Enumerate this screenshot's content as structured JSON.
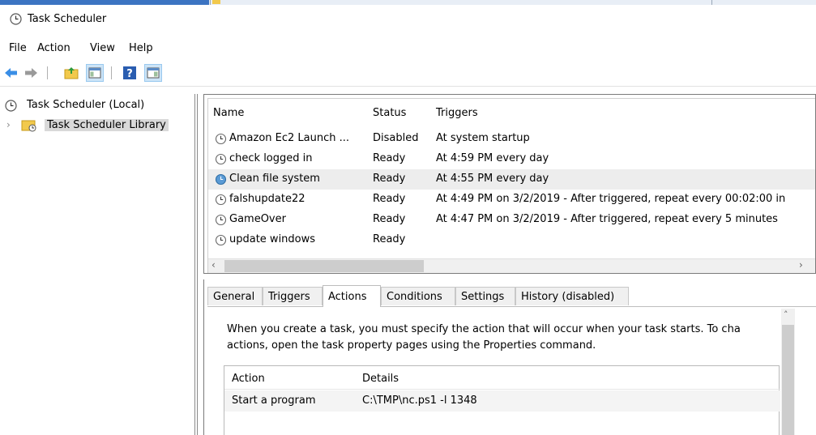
{
  "window": {
    "title": "Task Scheduler"
  },
  "menu": [
    "File",
    "Action",
    "View",
    "Help"
  ],
  "toolbar": {
    "icons": [
      "back-arrow-icon",
      "forward-arrow-icon",
      "up-folder-icon",
      "show-hide-console-tree-icon",
      "help-icon",
      "show-hide-action-pane-icon"
    ]
  },
  "tree": {
    "root": "Task Scheduler (Local)",
    "library": "Task Scheduler Library"
  },
  "task_list": {
    "columns": [
      "Name",
      "Status",
      "Triggers"
    ],
    "rows": [
      {
        "name": "Amazon Ec2 Launch ...",
        "status": "Disabled",
        "triggers": "At system startup"
      },
      {
        "name": "check logged in",
        "status": "Ready",
        "triggers": "At 4:59 PM every day"
      },
      {
        "name": "Clean file system",
        "status": "Ready",
        "triggers": "At 4:55 PM every day"
      },
      {
        "name": "falshupdate22",
        "status": "Ready",
        "triggers": "At 4:49 PM on 3/2/2019 - After triggered, repeat every 00:02:00 in"
      },
      {
        "name": "GameOver",
        "status": "Ready",
        "triggers": "At 4:47 PM on 3/2/2019 - After triggered, repeat every 5 minutes"
      },
      {
        "name": "update windows",
        "status": "Ready",
        "triggers": ""
      }
    ]
  },
  "tabs": [
    "General",
    "Triggers",
    "Actions",
    "Conditions",
    "Settings",
    "History (disabled)"
  ],
  "active_tab": "Actions",
  "actions_panel": {
    "line1": "When you create a task, you must specify the action that will occur when your task starts.  To cha",
    "line2": "actions, open the task property pages using the Properties command.",
    "columns": [
      "Action",
      "Details"
    ],
    "rows": [
      {
        "action": "Start a program",
        "details": "C:\\TMP\\nc.ps1 -l 1348"
      }
    ]
  },
  "colors": {
    "selection_blue": "#3c74c2",
    "toolbar_active": "#cce4f7"
  }
}
